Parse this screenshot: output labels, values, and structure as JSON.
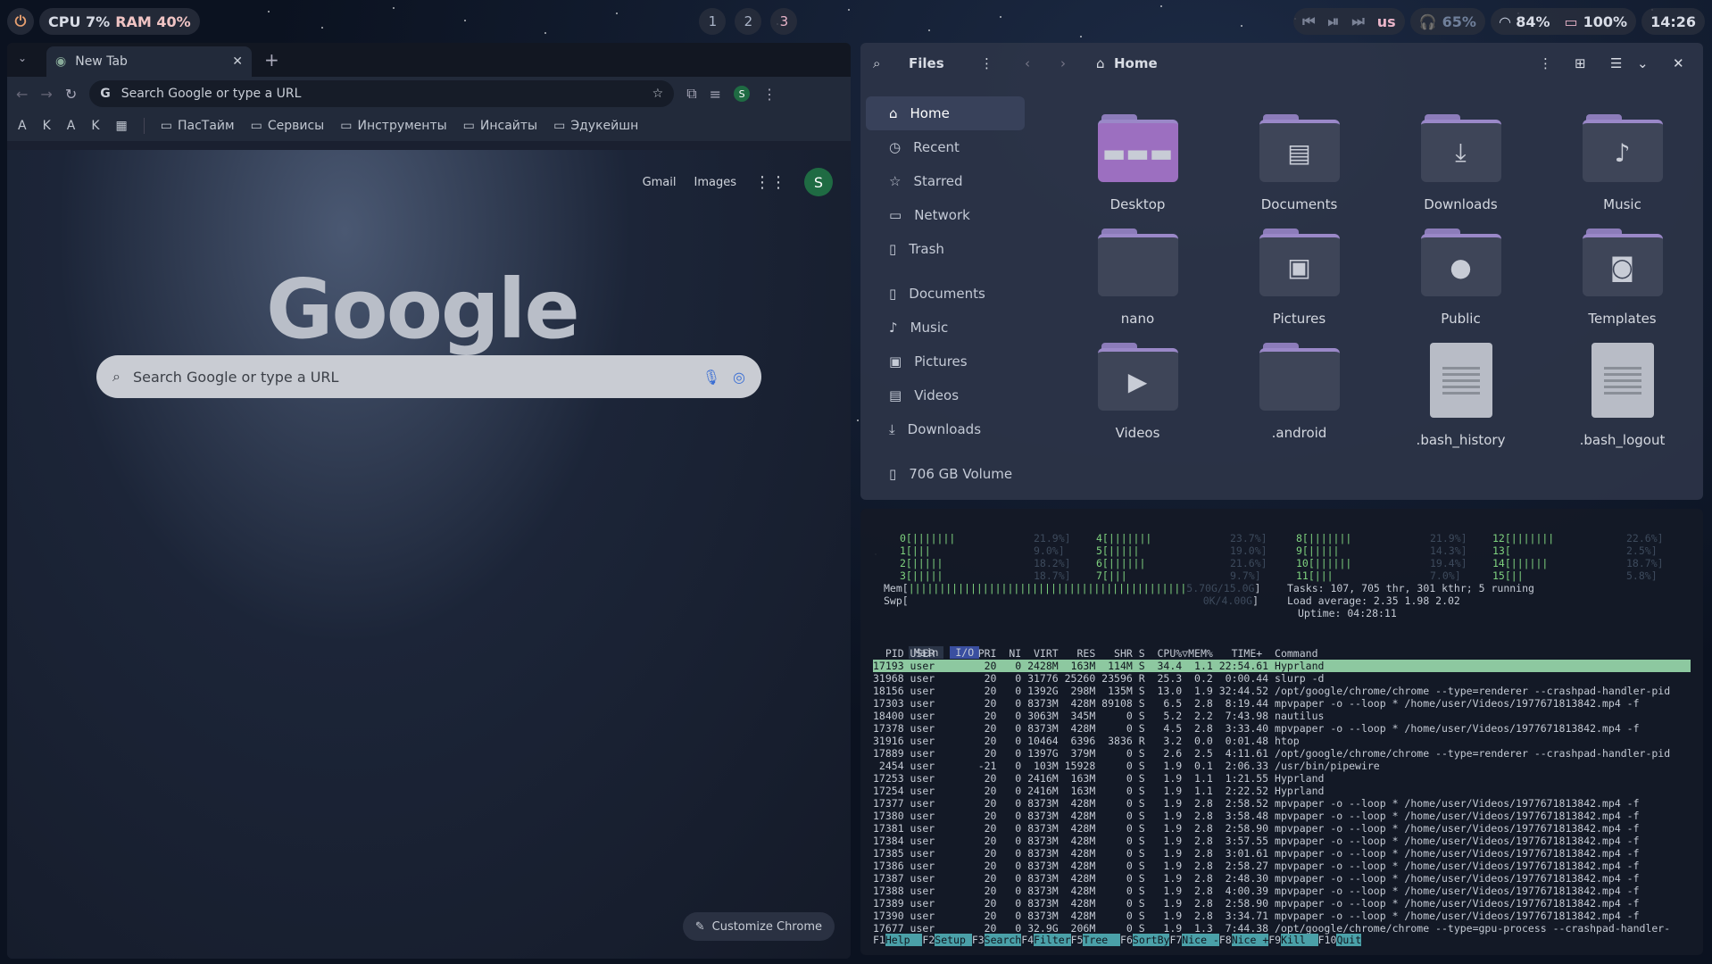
{
  "topbar": {
    "cpu": "CPU 7%",
    "ram": "RAM 40%",
    "workspaces": [
      "1",
      "2",
      "3"
    ],
    "layout": "us",
    "volume": "65%",
    "wifi": "84%",
    "battery": "100%",
    "clock": "14:26"
  },
  "chrome": {
    "tab_title": "New Tab",
    "omnibox_placeholder": "Search Google or type a URL",
    "profile_letter": "S",
    "bookmark_apps": [
      "A",
      "K",
      "A",
      "K"
    ],
    "bookmarks": [
      "ПасТайм",
      "Сервисы",
      "Инструменты",
      "Инсайты",
      "Эдукейшн"
    ],
    "ntp_links": [
      "Gmail",
      "Images"
    ],
    "logo": "Google",
    "search_placeholder": "Search Google or type a URL",
    "customize": "Customize Chrome"
  },
  "files": {
    "title": "Files",
    "location": "Home",
    "sidebar": [
      "Home",
      "Recent",
      "Starred",
      "Network",
      "Trash",
      "Documents",
      "Music",
      "Pictures",
      "Videos",
      "Downloads",
      "706 GB Volume"
    ],
    "items": [
      {
        "name": "Desktop",
        "icon": "folder"
      },
      {
        "name": "Documents",
        "icon": "folder"
      },
      {
        "name": "Downloads",
        "icon": "folder"
      },
      {
        "name": "Music",
        "icon": "folder"
      },
      {
        "name": "nano",
        "icon": "folder"
      },
      {
        "name": "Pictures",
        "icon": "folder"
      },
      {
        "name": "Public",
        "icon": "folder"
      },
      {
        "name": "Templates",
        "icon": "folder"
      },
      {
        "name": "Videos",
        "icon": "folder"
      },
      {
        "name": ".android",
        "icon": "folder"
      },
      {
        "name": ".bash_history",
        "icon": "file"
      },
      {
        "name": ".bash_logout",
        "icon": "file"
      }
    ]
  },
  "htop": {
    "cpus": [
      [
        "0[|||||||",
        "21.9%]",
        "4[|||||||",
        "23.7%]",
        "8[|||||||",
        "21.9%]",
        "12[|||||||",
        "22.6%]"
      ],
      [
        "1[|||",
        "9.0%]",
        "5[|||||",
        "19.0%]",
        "9[|||||",
        "14.3%]",
        "13[",
        "2.5%]"
      ],
      [
        "2[|||||",
        "18.2%]",
        "6[||||||",
        "21.6%]",
        "10[||||||",
        "19.4%]",
        "14[||||||",
        "18.7%]"
      ],
      [
        "3[|||||",
        "18.7%]",
        "7[|||",
        "9.7%]",
        "11[|||",
        "7.0%]",
        "15[||",
        "5.8%]"
      ]
    ],
    "mem": "5.70G/15.0G",
    "swp": "0K/4.00G",
    "tasks": "Tasks: 107, 705 thr, 301 kthr; 5 running",
    "load": "Load average: 2.35 1.98 2.02",
    "uptime": "Uptime: 04:28:11",
    "tabs": [
      "Main",
      "I/O"
    ],
    "header": "  PID USER       PRI  NI  VIRT   RES   SHR S  CPU%▽MEM%   TIME+  Command",
    "rows": [
      "17193 user        20   0 2428M  163M  114M S  34.4  1.1 22:54.61 Hyprland",
      "31968 user        20   0 31776 25260 23596 R  25.3  0.2  0:00.44 slurp -d",
      "18156 user        20   0 1392G  298M  135M S  13.0  1.9 32:44.52 /opt/google/chrome/chrome --type=renderer --crashpad-handler-pid",
      "17303 user        20   0 8373M  428M 89108 S   6.5  2.8  8:19.44 mpvpaper -o --loop * /home/user/Videos/1977671813842.mp4 -f",
      "18400 user        20   0 3063M  345M     0 S   5.2  2.2  7:43.98 nautilus",
      "17378 user        20   0 8373M  428M     0 S   4.5  2.8  3:33.40 mpvpaper -o --loop * /home/user/Videos/1977671813842.mp4 -f",
      "31916 user        20   0 10464  6396  3836 R   3.2  0.0  0:01.48 htop",
      "17889 user        20   0 1397G  379M     0 S   2.6  2.5  4:11.61 /opt/google/chrome/chrome --type=renderer --crashpad-handler-pid",
      " 2454 user       -21   0  103M 15928     0 S   1.9  0.1  2:06.33 /usr/bin/pipewire",
      "17253 user        20   0 2416M  163M     0 S   1.9  1.1  1:21.55 Hyprland",
      "17254 user        20   0 2416M  163M     0 S   1.9  1.1  2:22.52 Hyprland",
      "17377 user        20   0 8373M  428M     0 S   1.9  2.8  2:58.52 mpvpaper -o --loop * /home/user/Videos/1977671813842.mp4 -f",
      "17380 user        20   0 8373M  428M     0 S   1.9  2.8  3:58.48 mpvpaper -o --loop * /home/user/Videos/1977671813842.mp4 -f",
      "17381 user        20   0 8373M  428M     0 S   1.9  2.8  2:58.90 mpvpaper -o --loop * /home/user/Videos/1977671813842.mp4 -f",
      "17384 user        20   0 8373M  428M     0 S   1.9  2.8  3:57.55 mpvpaper -o --loop * /home/user/Videos/1977671813842.mp4 -f",
      "17385 user        20   0 8373M  428M     0 S   1.9  2.8  3:01.61 mpvpaper -o --loop * /home/user/Videos/1977671813842.mp4 -f",
      "17386 user        20   0 8373M  428M     0 S   1.9  2.8  2:58.27 mpvpaper -o --loop * /home/user/Videos/1977671813842.mp4 -f",
      "17387 user        20   0 8373M  428M     0 S   1.9  2.8  2:48.30 mpvpaper -o --loop * /home/user/Videos/1977671813842.mp4 -f",
      "17388 user        20   0 8373M  428M     0 S   1.9  2.8  4:00.39 mpvpaper -o --loop * /home/user/Videos/1977671813842.mp4 -f",
      "17389 user        20   0 8373M  428M     0 S   1.9  2.8  2:58.90 mpvpaper -o --loop * /home/user/Videos/1977671813842.mp4 -f",
      "17390 user        20   0 8373M  428M     0 S   1.9  2.8  3:34.71 mpvpaper -o --loop * /home/user/Videos/1977671813842.mp4 -f",
      "17677 user        20   0 32.9G  206M     0 S   1.9  1.3  7:44.38 /opt/google/chrome/chrome --type=gpu-process --crashpad-handler-"
    ],
    "fkeys": [
      [
        "F1",
        "Help  "
      ],
      [
        "F2",
        "Setup "
      ],
      [
        "F3",
        "Search"
      ],
      [
        "F4",
        "Filter"
      ],
      [
        "F5",
        "Tree  "
      ],
      [
        "F6",
        "SortBy"
      ],
      [
        "F7",
        "Nice -"
      ],
      [
        "F8",
        "Nice +"
      ],
      [
        "F9",
        "Kill  "
      ],
      [
        "F10",
        "Quit"
      ]
    ]
  }
}
